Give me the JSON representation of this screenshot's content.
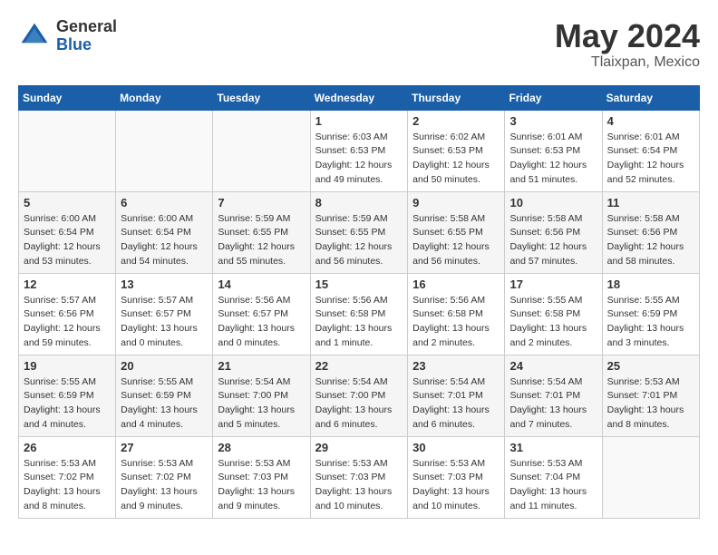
{
  "header": {
    "logo_general": "General",
    "logo_blue": "Blue",
    "month_title": "May 2024",
    "location": "Tlaixpan, Mexico"
  },
  "weekdays": [
    "Sunday",
    "Monday",
    "Tuesday",
    "Wednesday",
    "Thursday",
    "Friday",
    "Saturday"
  ],
  "weeks": [
    [
      {
        "day": "",
        "info": ""
      },
      {
        "day": "",
        "info": ""
      },
      {
        "day": "",
        "info": ""
      },
      {
        "day": "1",
        "info": "Sunrise: 6:03 AM\nSunset: 6:53 PM\nDaylight: 12 hours\nand 49 minutes."
      },
      {
        "day": "2",
        "info": "Sunrise: 6:02 AM\nSunset: 6:53 PM\nDaylight: 12 hours\nand 50 minutes."
      },
      {
        "day": "3",
        "info": "Sunrise: 6:01 AM\nSunset: 6:53 PM\nDaylight: 12 hours\nand 51 minutes."
      },
      {
        "day": "4",
        "info": "Sunrise: 6:01 AM\nSunset: 6:54 PM\nDaylight: 12 hours\nand 52 minutes."
      }
    ],
    [
      {
        "day": "5",
        "info": "Sunrise: 6:00 AM\nSunset: 6:54 PM\nDaylight: 12 hours\nand 53 minutes."
      },
      {
        "day": "6",
        "info": "Sunrise: 6:00 AM\nSunset: 6:54 PM\nDaylight: 12 hours\nand 54 minutes."
      },
      {
        "day": "7",
        "info": "Sunrise: 5:59 AM\nSunset: 6:55 PM\nDaylight: 12 hours\nand 55 minutes."
      },
      {
        "day": "8",
        "info": "Sunrise: 5:59 AM\nSunset: 6:55 PM\nDaylight: 12 hours\nand 56 minutes."
      },
      {
        "day": "9",
        "info": "Sunrise: 5:58 AM\nSunset: 6:55 PM\nDaylight: 12 hours\nand 56 minutes."
      },
      {
        "day": "10",
        "info": "Sunrise: 5:58 AM\nSunset: 6:56 PM\nDaylight: 12 hours\nand 57 minutes."
      },
      {
        "day": "11",
        "info": "Sunrise: 5:58 AM\nSunset: 6:56 PM\nDaylight: 12 hours\nand 58 minutes."
      }
    ],
    [
      {
        "day": "12",
        "info": "Sunrise: 5:57 AM\nSunset: 6:56 PM\nDaylight: 12 hours\nand 59 minutes."
      },
      {
        "day": "13",
        "info": "Sunrise: 5:57 AM\nSunset: 6:57 PM\nDaylight: 13 hours\nand 0 minutes."
      },
      {
        "day": "14",
        "info": "Sunrise: 5:56 AM\nSunset: 6:57 PM\nDaylight: 13 hours\nand 0 minutes."
      },
      {
        "day": "15",
        "info": "Sunrise: 5:56 AM\nSunset: 6:58 PM\nDaylight: 13 hours\nand 1 minute."
      },
      {
        "day": "16",
        "info": "Sunrise: 5:56 AM\nSunset: 6:58 PM\nDaylight: 13 hours\nand 2 minutes."
      },
      {
        "day": "17",
        "info": "Sunrise: 5:55 AM\nSunset: 6:58 PM\nDaylight: 13 hours\nand 2 minutes."
      },
      {
        "day": "18",
        "info": "Sunrise: 5:55 AM\nSunset: 6:59 PM\nDaylight: 13 hours\nand 3 minutes."
      }
    ],
    [
      {
        "day": "19",
        "info": "Sunrise: 5:55 AM\nSunset: 6:59 PM\nDaylight: 13 hours\nand 4 minutes."
      },
      {
        "day": "20",
        "info": "Sunrise: 5:55 AM\nSunset: 6:59 PM\nDaylight: 13 hours\nand 4 minutes."
      },
      {
        "day": "21",
        "info": "Sunrise: 5:54 AM\nSunset: 7:00 PM\nDaylight: 13 hours\nand 5 minutes."
      },
      {
        "day": "22",
        "info": "Sunrise: 5:54 AM\nSunset: 7:00 PM\nDaylight: 13 hours\nand 6 minutes."
      },
      {
        "day": "23",
        "info": "Sunrise: 5:54 AM\nSunset: 7:01 PM\nDaylight: 13 hours\nand 6 minutes."
      },
      {
        "day": "24",
        "info": "Sunrise: 5:54 AM\nSunset: 7:01 PM\nDaylight: 13 hours\nand 7 minutes."
      },
      {
        "day": "25",
        "info": "Sunrise: 5:53 AM\nSunset: 7:01 PM\nDaylight: 13 hours\nand 8 minutes."
      }
    ],
    [
      {
        "day": "26",
        "info": "Sunrise: 5:53 AM\nSunset: 7:02 PM\nDaylight: 13 hours\nand 8 minutes."
      },
      {
        "day": "27",
        "info": "Sunrise: 5:53 AM\nSunset: 7:02 PM\nDaylight: 13 hours\nand 9 minutes."
      },
      {
        "day": "28",
        "info": "Sunrise: 5:53 AM\nSunset: 7:03 PM\nDaylight: 13 hours\nand 9 minutes."
      },
      {
        "day": "29",
        "info": "Sunrise: 5:53 AM\nSunset: 7:03 PM\nDaylight: 13 hours\nand 10 minutes."
      },
      {
        "day": "30",
        "info": "Sunrise: 5:53 AM\nSunset: 7:03 PM\nDaylight: 13 hours\nand 10 minutes."
      },
      {
        "day": "31",
        "info": "Sunrise: 5:53 AM\nSunset: 7:04 PM\nDaylight: 13 hours\nand 11 minutes."
      },
      {
        "day": "",
        "info": ""
      }
    ]
  ]
}
